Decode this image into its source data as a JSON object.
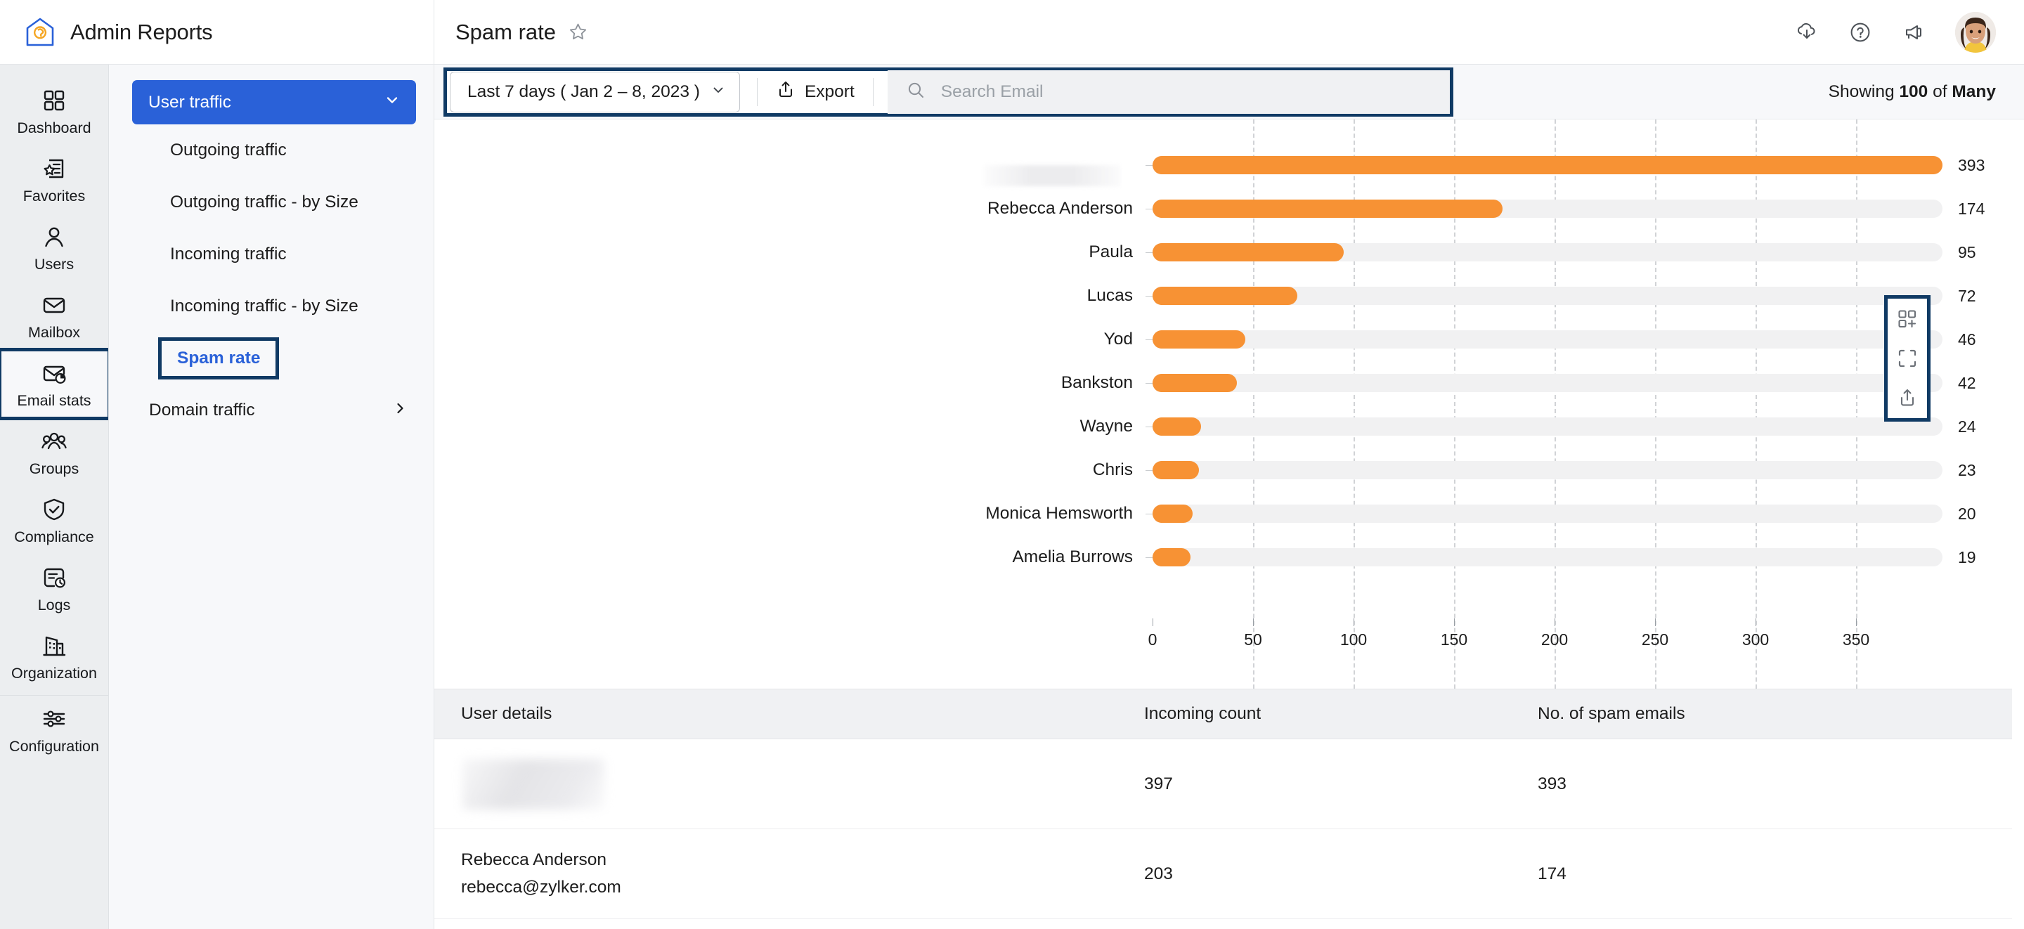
{
  "app": {
    "brand": "Admin Reports",
    "logo_icon": "house-gear-icon"
  },
  "header": {
    "page_title": "Spam rate",
    "favorite_icon": "star-outline-icon",
    "actions": [
      {
        "name": "cloud-download-icon",
        "label": "Download"
      },
      {
        "name": "help-icon",
        "label": "Help"
      },
      {
        "name": "announcement-icon",
        "label": "Announcements"
      }
    ],
    "avatar_icon": "user-avatar"
  },
  "rail": {
    "items": [
      {
        "label": "Dashboard",
        "icon": "grid-icon",
        "active": false
      },
      {
        "label": "Favorites",
        "icon": "star-list-icon",
        "active": false
      },
      {
        "label": "Users",
        "icon": "user-icon",
        "active": false
      },
      {
        "label": "Mailbox",
        "icon": "envelope-icon",
        "active": false
      },
      {
        "label": "Email stats",
        "icon": "mail-chart-icon",
        "active": true
      },
      {
        "label": "Groups",
        "icon": "group-icon",
        "active": false
      },
      {
        "label": "Compliance",
        "icon": "shield-check-icon",
        "active": false
      },
      {
        "label": "Logs",
        "icon": "log-clock-icon",
        "active": false
      },
      {
        "label": "Organization",
        "icon": "building-icon",
        "active": false
      },
      {
        "label": "Configuration",
        "icon": "sliders-icon",
        "active": false
      }
    ]
  },
  "subnav": {
    "group_label": "User traffic",
    "group_chevron_icon": "chevron-down-icon",
    "items": [
      {
        "label": "Outgoing traffic",
        "selected": false,
        "expandable": false
      },
      {
        "label": "Outgoing traffic - by Size",
        "selected": false,
        "expandable": false
      },
      {
        "label": "Incoming traffic",
        "selected": false,
        "expandable": false
      },
      {
        "label": "Incoming traffic - by Size",
        "selected": false,
        "expandable": false
      },
      {
        "label": "Spam rate",
        "selected": true,
        "expandable": false
      },
      {
        "label": "Domain traffic",
        "selected": false,
        "expandable": true,
        "chevron_icon": "chevron-right-icon"
      }
    ]
  },
  "toolbar": {
    "date_filter": "Last 7 days ( Jan 2 – 8, 2023 )",
    "date_chevron_icon": "chevron-down-icon",
    "export_label": "Export",
    "export_icon": "export-upload-icon",
    "search_icon": "search-icon",
    "search_placeholder": "Search Email",
    "search_value": "",
    "showing_prefix": "Showing ",
    "showing_count": "100",
    "showing_mid": " of ",
    "showing_total": "Many"
  },
  "chart_tools": [
    {
      "name": "add-to-dashboard-icon"
    },
    {
      "name": "fullscreen-icon"
    },
    {
      "name": "share-icon"
    }
  ],
  "chart_data": {
    "type": "bar",
    "orientation": "horizontal",
    "title": "Spam rate",
    "xlabel": "",
    "ylabel": "",
    "xlim": [
      0,
      393
    ],
    "ticks": [
      0,
      50,
      100,
      150,
      200,
      250,
      300,
      350
    ],
    "tick_labels": [
      "0",
      "50",
      "100",
      "150",
      "200",
      "250",
      "300",
      "350"
    ],
    "grid": true,
    "bar_color": "#f79234",
    "track_color": "#f1f1f2",
    "categories": [
      "",
      "Rebecca Anderson",
      "Paula",
      "Lucas",
      "Yod",
      "Bankston",
      "Wayne",
      "Chris",
      "Monica Hemsworth",
      "Amelia Burrows"
    ],
    "category_redacted": [
      true,
      false,
      false,
      false,
      false,
      false,
      false,
      false,
      false,
      false
    ],
    "values": [
      393,
      174,
      95,
      72,
      46,
      42,
      24,
      23,
      20,
      19
    ],
    "value_labels": [
      "393",
      "174",
      "95",
      "72",
      "46",
      "42",
      "24",
      "23",
      "20",
      "19"
    ]
  },
  "table": {
    "columns": [
      "User details",
      "Incoming count",
      "No. of spam emails"
    ],
    "rows": [
      {
        "name": "",
        "email": "",
        "redacted": true,
        "incoming": "397",
        "spam": "393"
      },
      {
        "name": "Rebecca Anderson",
        "email": "rebecca@zylker.com",
        "redacted": false,
        "incoming": "203",
        "spam": "174"
      }
    ]
  }
}
